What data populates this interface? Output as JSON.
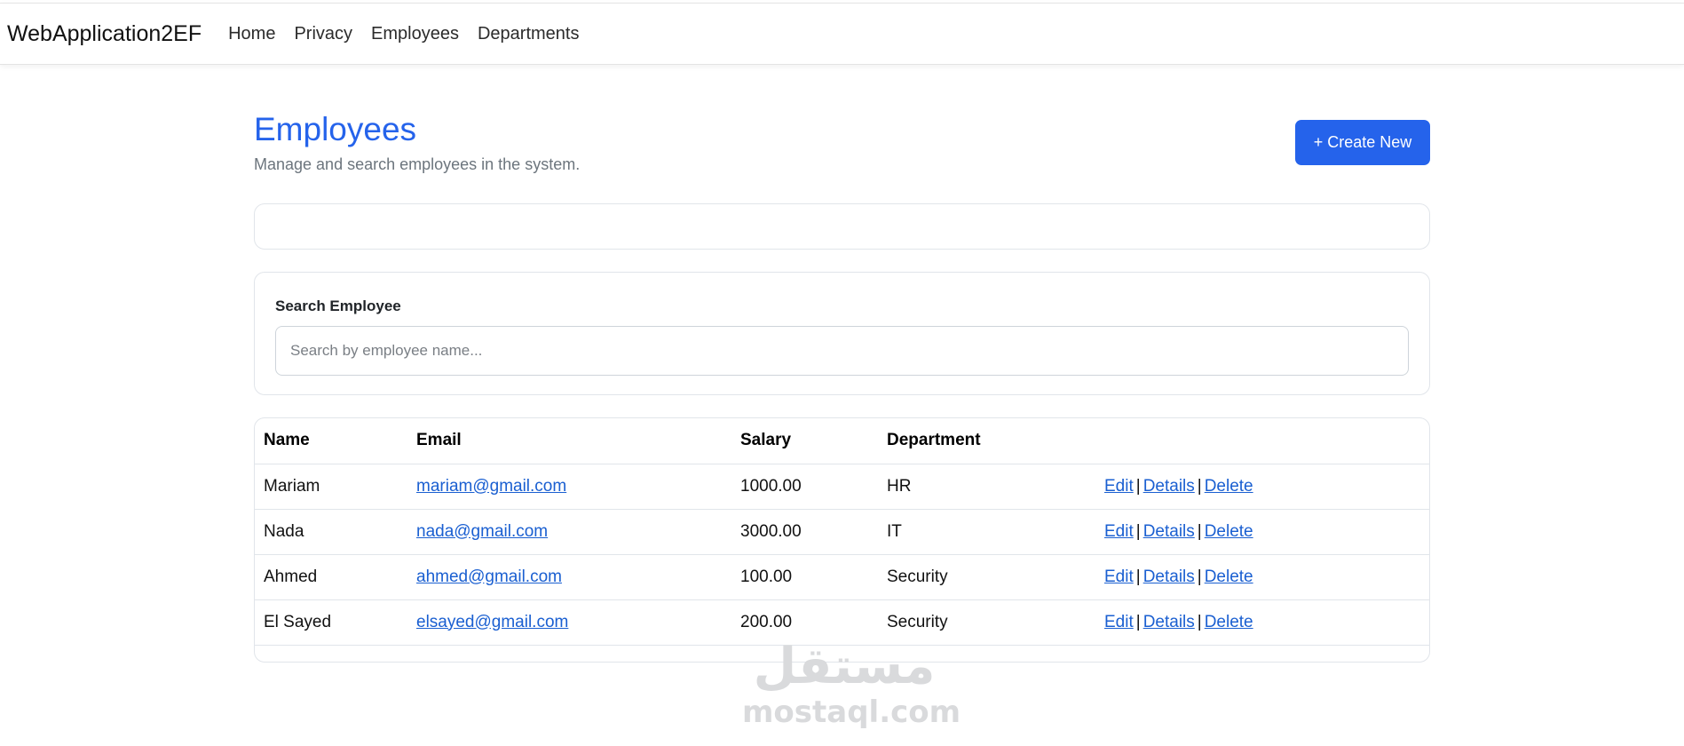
{
  "navbar": {
    "brand": "WebApplication2EF",
    "links": [
      "Home",
      "Privacy",
      "Employees",
      "Departments"
    ]
  },
  "header": {
    "title": "Employees",
    "subtitle": "Manage and search employees in the system.",
    "create_button": "+ Create New"
  },
  "search": {
    "label": "Search Employee",
    "placeholder": "Search by employee name...",
    "value": ""
  },
  "table": {
    "columns": [
      "Name",
      "Email",
      "Salary",
      "Department",
      ""
    ],
    "rows": [
      {
        "name": "Mariam",
        "email": "mariam@gmail.com",
        "salary": "1000.00",
        "department": "HR"
      },
      {
        "name": "Nada",
        "email": "nada@gmail.com",
        "salary": "3000.00",
        "department": "IT"
      },
      {
        "name": "Ahmed",
        "email": "ahmed@gmail.com",
        "salary": "100.00",
        "department": "Security"
      },
      {
        "name": "El Sayed",
        "email": "elsayed@gmail.com",
        "salary": "200.00",
        "department": "Security"
      }
    ],
    "actions": {
      "edit": "Edit",
      "details": "Details",
      "delete": "Delete",
      "separator": "|"
    }
  },
  "watermark": {
    "arabic": "مستقل",
    "latin": "mostaql.com"
  },
  "colors": {
    "accent": "#2563eb",
    "link": "#1a5fd1",
    "muted": "#6c757d",
    "border": "#e1e5ea"
  }
}
